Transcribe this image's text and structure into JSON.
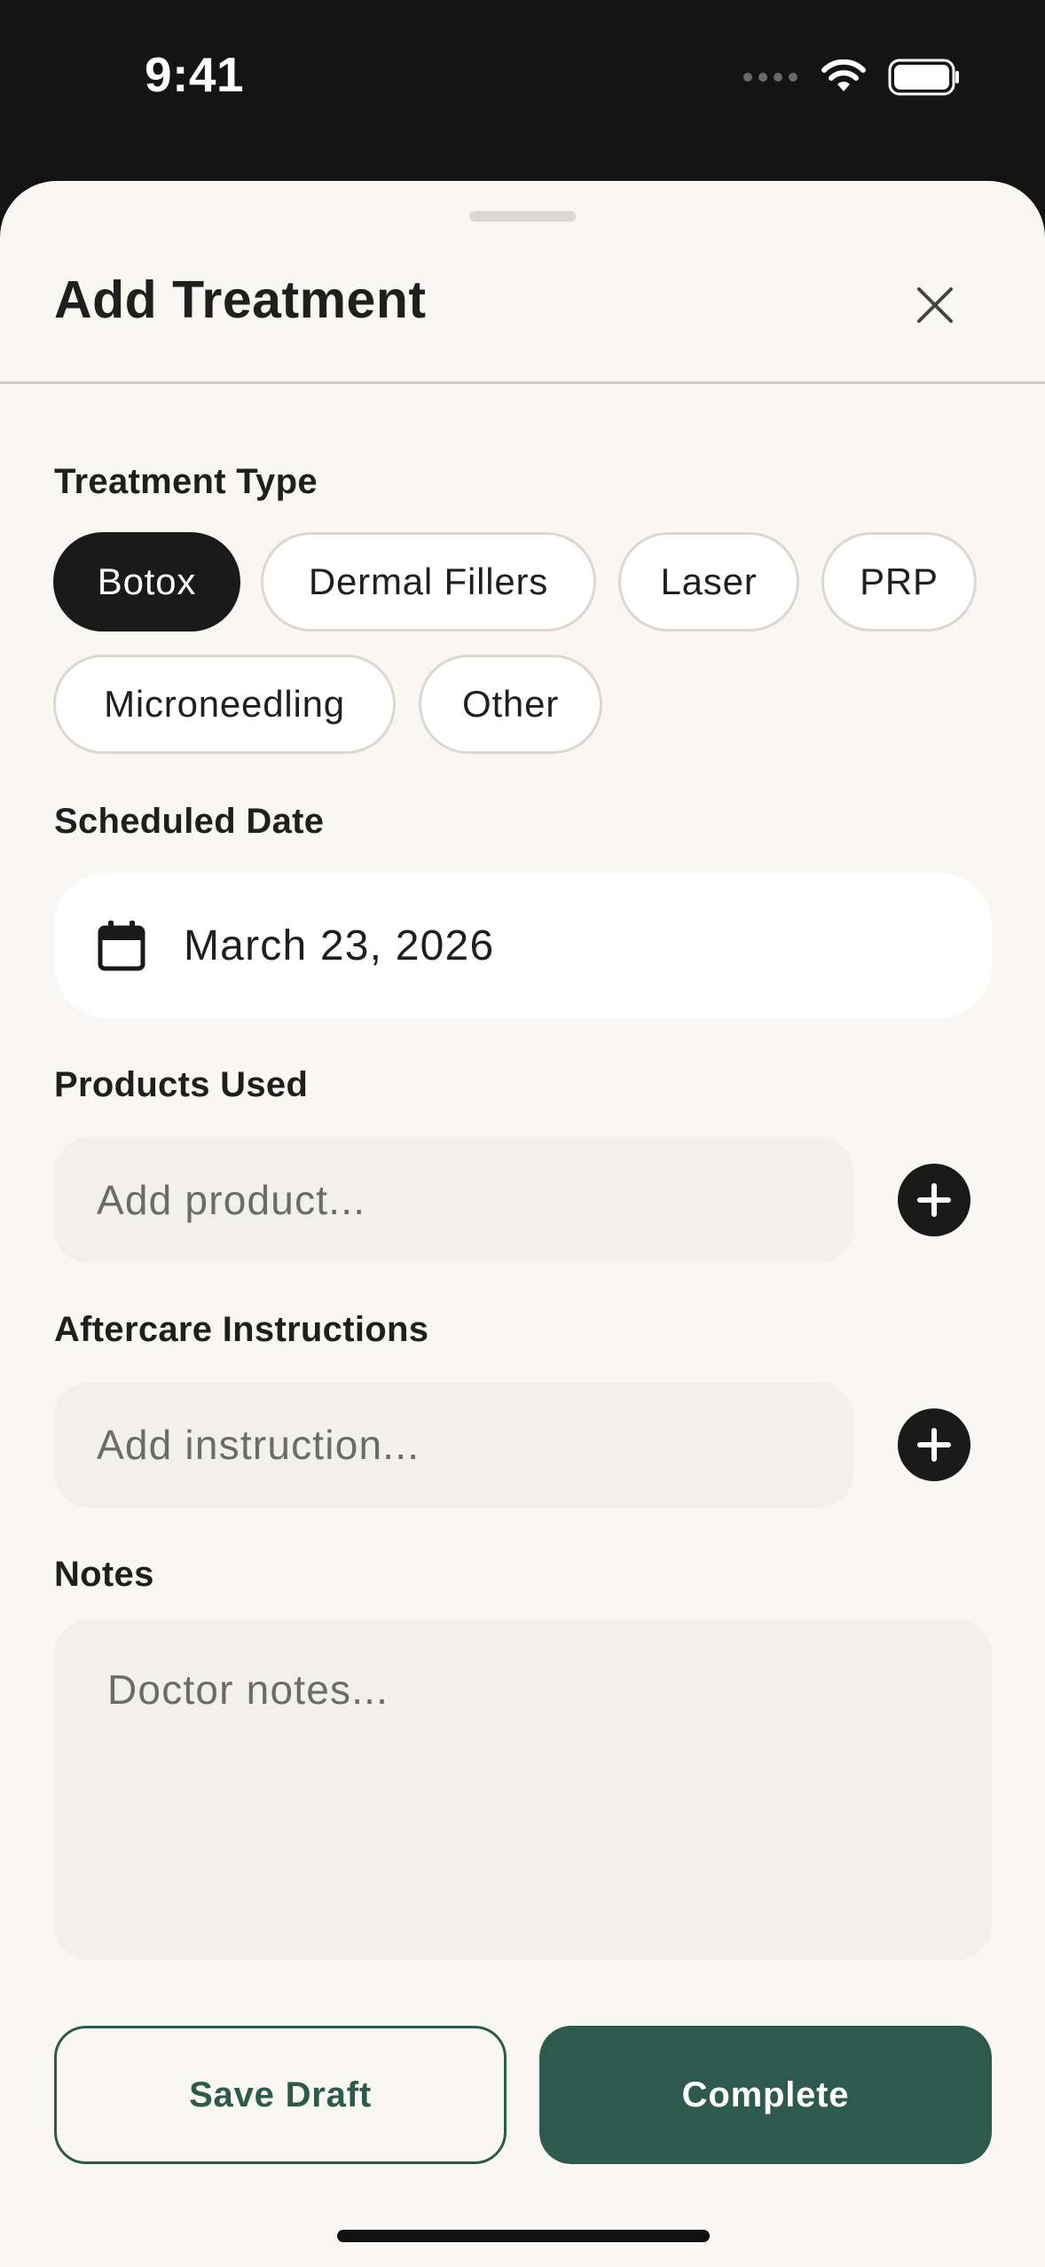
{
  "status_bar": {
    "time": "9:41"
  },
  "sheet": {
    "title": "Add Treatment"
  },
  "treatment_type": {
    "label": "Treatment Type",
    "options": [
      "Botox",
      "Dermal Fillers",
      "Laser",
      "PRP",
      "Microneedling",
      "Other"
    ],
    "selected": "Botox"
  },
  "scheduled_date": {
    "label": "Scheduled Date",
    "value": "March 23, 2026"
  },
  "products": {
    "label": "Products Used",
    "placeholder": "Add product..."
  },
  "aftercare": {
    "label": "Aftercare Instructions",
    "placeholder": "Add instruction..."
  },
  "notes": {
    "label": "Notes",
    "placeholder": "Doctor notes..."
  },
  "actions": {
    "save_draft": "Save Draft",
    "complete": "Complete"
  },
  "colors": {
    "accent": "#2d5a4c",
    "selected_chip": "#1a1a1a",
    "sheet_bg": "#f8f7f4",
    "status_bg": "#141414"
  }
}
